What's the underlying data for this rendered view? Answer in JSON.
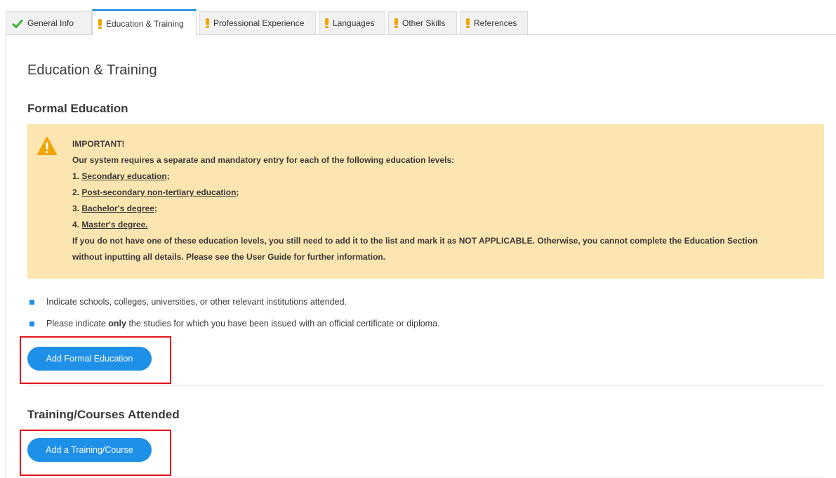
{
  "tabs": [
    {
      "label": "General Info",
      "status": "complete",
      "active": false
    },
    {
      "label": "Education & Training",
      "status": "incomplete",
      "active": true
    },
    {
      "label": "Professional Experience",
      "status": "incomplete",
      "active": false
    },
    {
      "label": "Languages",
      "status": "incomplete",
      "active": false
    },
    {
      "label": "Other Skills",
      "status": "incomplete",
      "active": false
    },
    {
      "label": "References",
      "status": "incomplete",
      "active": false
    }
  ],
  "page_title": "Education & Training",
  "formal_education": {
    "heading": "Formal Education",
    "warning": {
      "title": "IMPORTANT!",
      "intro": "Our system requires a separate and mandatory entry for each of the following education levels:",
      "levels": [
        {
          "num": "1.",
          "text": "Secondary education",
          "suffix": ";"
        },
        {
          "num": "2.",
          "text": "Post-secondary non-tertiary education",
          "suffix": ";"
        },
        {
          "num": "3.",
          "text": "Bachelor's degree",
          "suffix": ";"
        },
        {
          "num": "4.",
          "text": "Master's degree.",
          "suffix": ""
        }
      ],
      "note_line1": "If you do not have one of these education levels, you still need to add it to the list and mark it as NOT APPLICABLE. Otherwise, you cannot complete the Education Section",
      "note_line2": "without inputting all details. Please see the User Guide for further information."
    },
    "bullet1": "Indicate schools, colleges, universities, or other relevant institutions attended.",
    "bullet2_pre": "Please indicate ",
    "bullet2_bold": "only",
    "bullet2_post": " the studies for which you have been issued with an official certificate or diploma.",
    "add_button": "Add Formal Education"
  },
  "training": {
    "heading": "Training/Courses Attended",
    "add_button": "Add a Training/Course"
  },
  "colors": {
    "accent": "#1e90e8",
    "warning_bg": "#fce5b0",
    "warning_icon": "#f0a500",
    "complete_check": "#3db33d",
    "highlight": "#e2141c"
  }
}
